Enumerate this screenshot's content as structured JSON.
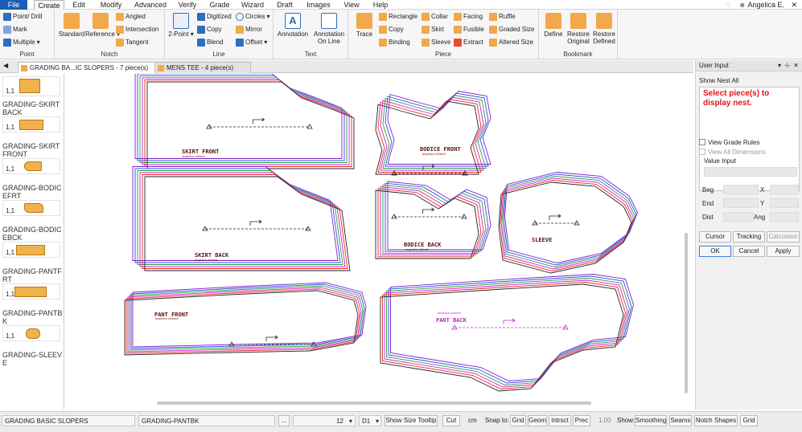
{
  "menu": {
    "file": "File",
    "create": "Create",
    "edit": "Edit",
    "modify": "Modify",
    "advanced": "Advanced",
    "verify": "Verify",
    "grade": "Grade",
    "wizard": "Wizard",
    "draft": "Draft",
    "images": "Images",
    "view": "View",
    "help": "Help"
  },
  "user": {
    "name": "Angelica E."
  },
  "ribbon": {
    "point": {
      "label": "Point",
      "point_drill": "Point/ Drill",
      "mark": "Mark",
      "multiple": "Multiple"
    },
    "notch": {
      "label": "Notch",
      "standard": "Standard",
      "reference": "Reference",
      "angled": "Angled",
      "intersection": "Intersection",
      "tangent": "Tangent"
    },
    "line": {
      "label": "Line",
      "two_point": "2-Point",
      "digitized": "Digitized",
      "copy": "Copy",
      "blend": "Blend",
      "circles": "Circles",
      "mirror": "Mirror",
      "offset": "Offset"
    },
    "text": {
      "label": "Text",
      "annotation": "Annotation",
      "annotation_on_line_1": "Annotation",
      "annotation_on_line_2": "On Line"
    },
    "piece": {
      "label": "Piece",
      "trace": "Trace",
      "rectangle": "Rectangle",
      "copy": "Copy",
      "binding": "Binding",
      "collar": "Collar",
      "skirt": "Skirt",
      "sleeve": "Sleeve",
      "facing": "Facing",
      "fusible": "Fusible",
      "extract": "Extract",
      "ruffle": "Ruffle",
      "graded_size": "Graded Size",
      "altered_size": "Altered Size"
    },
    "bookmark": {
      "label": "Bookmark",
      "define": "Define",
      "restore_original_1": "Restore",
      "restore_original_2": "Original",
      "restore_defined_1": "Restore",
      "restore_defined_2": "Defined"
    }
  },
  "tabs": [
    {
      "label": "GRADING BA...IC SLOPERS - 7 piece(s)"
    },
    {
      "label": "MENS TEE - 4 piece(s)"
    }
  ],
  "pieces": [
    {
      "count": "1,1",
      "name": ""
    },
    {
      "count": "1,1",
      "name": "GRADING-SKIRTBACK"
    },
    {
      "count": "1,1",
      "name": "GRADING-SKIRTFRONT"
    },
    {
      "count": "1,1",
      "name": "GRADING-BODICEFRT"
    },
    {
      "count": "1,1",
      "name": "GRADING-BODICEBCK"
    },
    {
      "count": "1,1",
      "name": "GRADING-PANTFRT"
    },
    {
      "count": "1,1",
      "name": "GRADING-PANTBK"
    },
    {
      "count": "",
      "name": "GRADING-SLEEVE"
    }
  ],
  "canvas": {
    "skirt_front": "SKIRT FRONT",
    "skirt_back": "SKIRT BACK",
    "bodice_front": "BODICE FRONT",
    "bodice_back": "BODICE BACK",
    "sleeve": "SLEEVE",
    "pant_front": "PANT FRONT",
    "pant_back": "PANT BACK",
    "author": "angelica villiardi",
    "colors": {
      "red": "#e8262a",
      "magenta": "#d11fd6",
      "blue": "#3b44e0",
      "green": "#22a33a",
      "purple": "#7a1fd0",
      "black": "#222222"
    }
  },
  "panel": {
    "title": "User Input",
    "show_nest_all": "Show Nest All",
    "message": "Select piece(s) to display nest.",
    "view_grade_rules": "View Grade Rules",
    "view_all_dimensions": "View All Dimensions",
    "value_input": "Value Input",
    "beg": "Beg",
    "x": "X",
    "end": "End",
    "y": "Y",
    "dist": "Dist",
    "ang": "Ang",
    "cursor": "Cursor",
    "tracking": "Tracking",
    "calculator": "Calculator",
    "ok": "OK",
    "cancel": "Cancel",
    "apply": "Apply"
  },
  "status": {
    "style_name": "GRADING BASIC SLOPERS",
    "piece_name": "GRADING-PANTBK",
    "ellipsis": "...",
    "size": "12",
    "d1": "D1",
    "show_size_tooltip": "Show Size Tooltip",
    "cut": "Cut",
    "unit": "cm",
    "snap_to": "Snap to:",
    "grid": "Grid",
    "geom": "Geom",
    "intrsct": "Intrsct",
    "prec": "Prec",
    "prec_value": "1.00",
    "show": "Show:",
    "smoothing": "Smoothing",
    "seams": "Seams",
    "notch_shapes": "Notch Shapes",
    "grid2": "Grid"
  }
}
